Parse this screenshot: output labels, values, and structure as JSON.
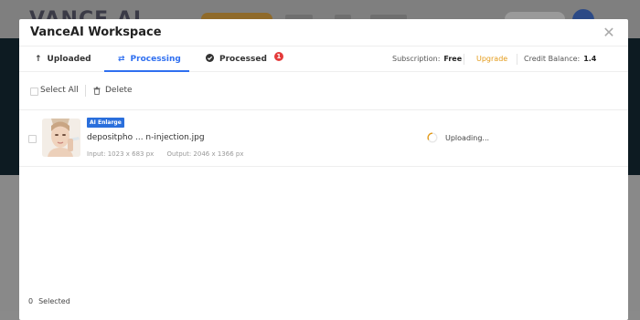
{
  "background": {
    "logo": "VANCE AI"
  },
  "modal": {
    "title": "VanceAI Workspace",
    "close_icon": "close-icon"
  },
  "tabs": [
    {
      "label": "Uploaded",
      "icon": "upload-arrow-icon",
      "active": false
    },
    {
      "label": "Processing",
      "icon": "sync-icon",
      "active": true
    },
    {
      "label": "Processed",
      "icon": "check-circle-icon",
      "active": false,
      "badge": "1"
    }
  ],
  "account": {
    "subscription_label": "Subscription:",
    "subscription_value": "Free",
    "upgrade_label": "Upgrade",
    "credit_label": "Credit Balance:",
    "credit_value": "1.4"
  },
  "toolbar": {
    "select_all_label": "Select All",
    "delete_label": "Delete"
  },
  "files": [
    {
      "tag": "AI Enlarge",
      "name": "depositpho ... n-injection.jpg",
      "input": "Input: 1023 x 683 px",
      "output": "Output: 2046 x 1366 px",
      "status": "Uploading..."
    }
  ],
  "footer": {
    "count": "0",
    "label": "Selected"
  },
  "colors": {
    "accent": "#2f6ff0",
    "upgrade": "#e49b1a",
    "badge": "#e43b3b",
    "tag": "#2a6fdc"
  }
}
